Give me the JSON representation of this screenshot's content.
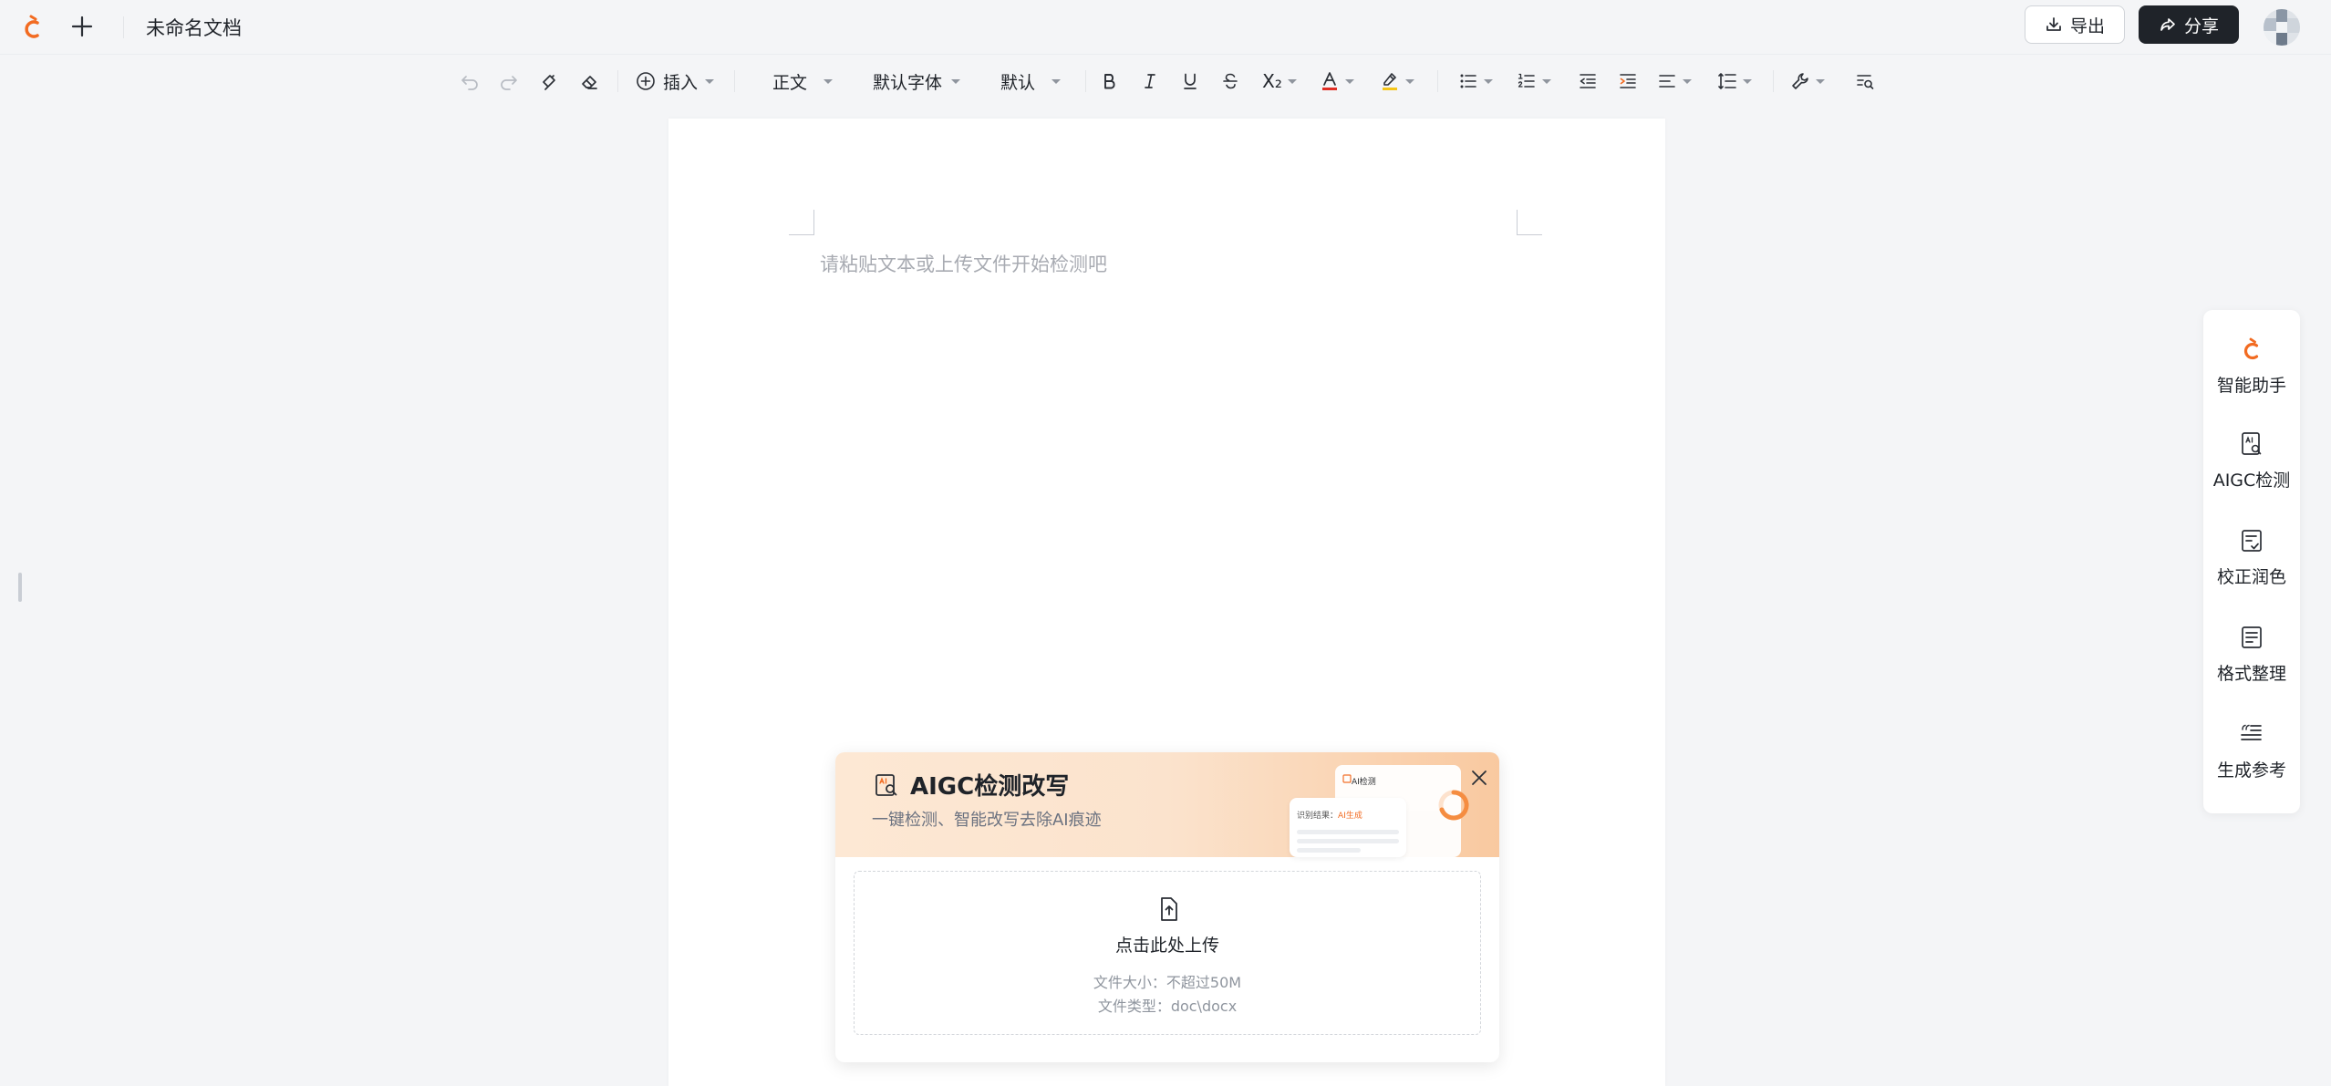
{
  "header": {
    "title": "未命名文档",
    "export_label": "导出",
    "share_label": "分享",
    "brand_color": "#f26b21"
  },
  "toolbar": {
    "insert_label": "插入",
    "paragraph_style": "正文",
    "font_family": "默认字体",
    "font_size": "默认",
    "subscript_glyph": "X₂",
    "font_color": "#e02e24",
    "highlight_color": "#f5c518"
  },
  "editor": {
    "placeholder": "请粘贴文本或上传文件开始检测吧"
  },
  "aigc_card": {
    "title": "AIGC检测改写",
    "subtitle": "一键检测、智能改写去除AI痕迹",
    "upload_label": "点击此处上传",
    "file_size_hint": "文件大小：不超过50M",
    "file_type_hint": "文件类型：doc\\docx",
    "mini_ai_label": "AI检测",
    "mini_result_label": "识别结果：",
    "mini_result_value": "AI生成"
  },
  "side_panel": {
    "items": [
      {
        "label": "智能助手",
        "icon": "assistant-icon"
      },
      {
        "label": "AIGC检测",
        "icon": "aigc-detect-icon"
      },
      {
        "label": "校正润色",
        "icon": "proofread-icon"
      },
      {
        "label": "格式整理",
        "icon": "format-icon"
      },
      {
        "label": "生成参考",
        "icon": "reference-icon"
      }
    ]
  }
}
